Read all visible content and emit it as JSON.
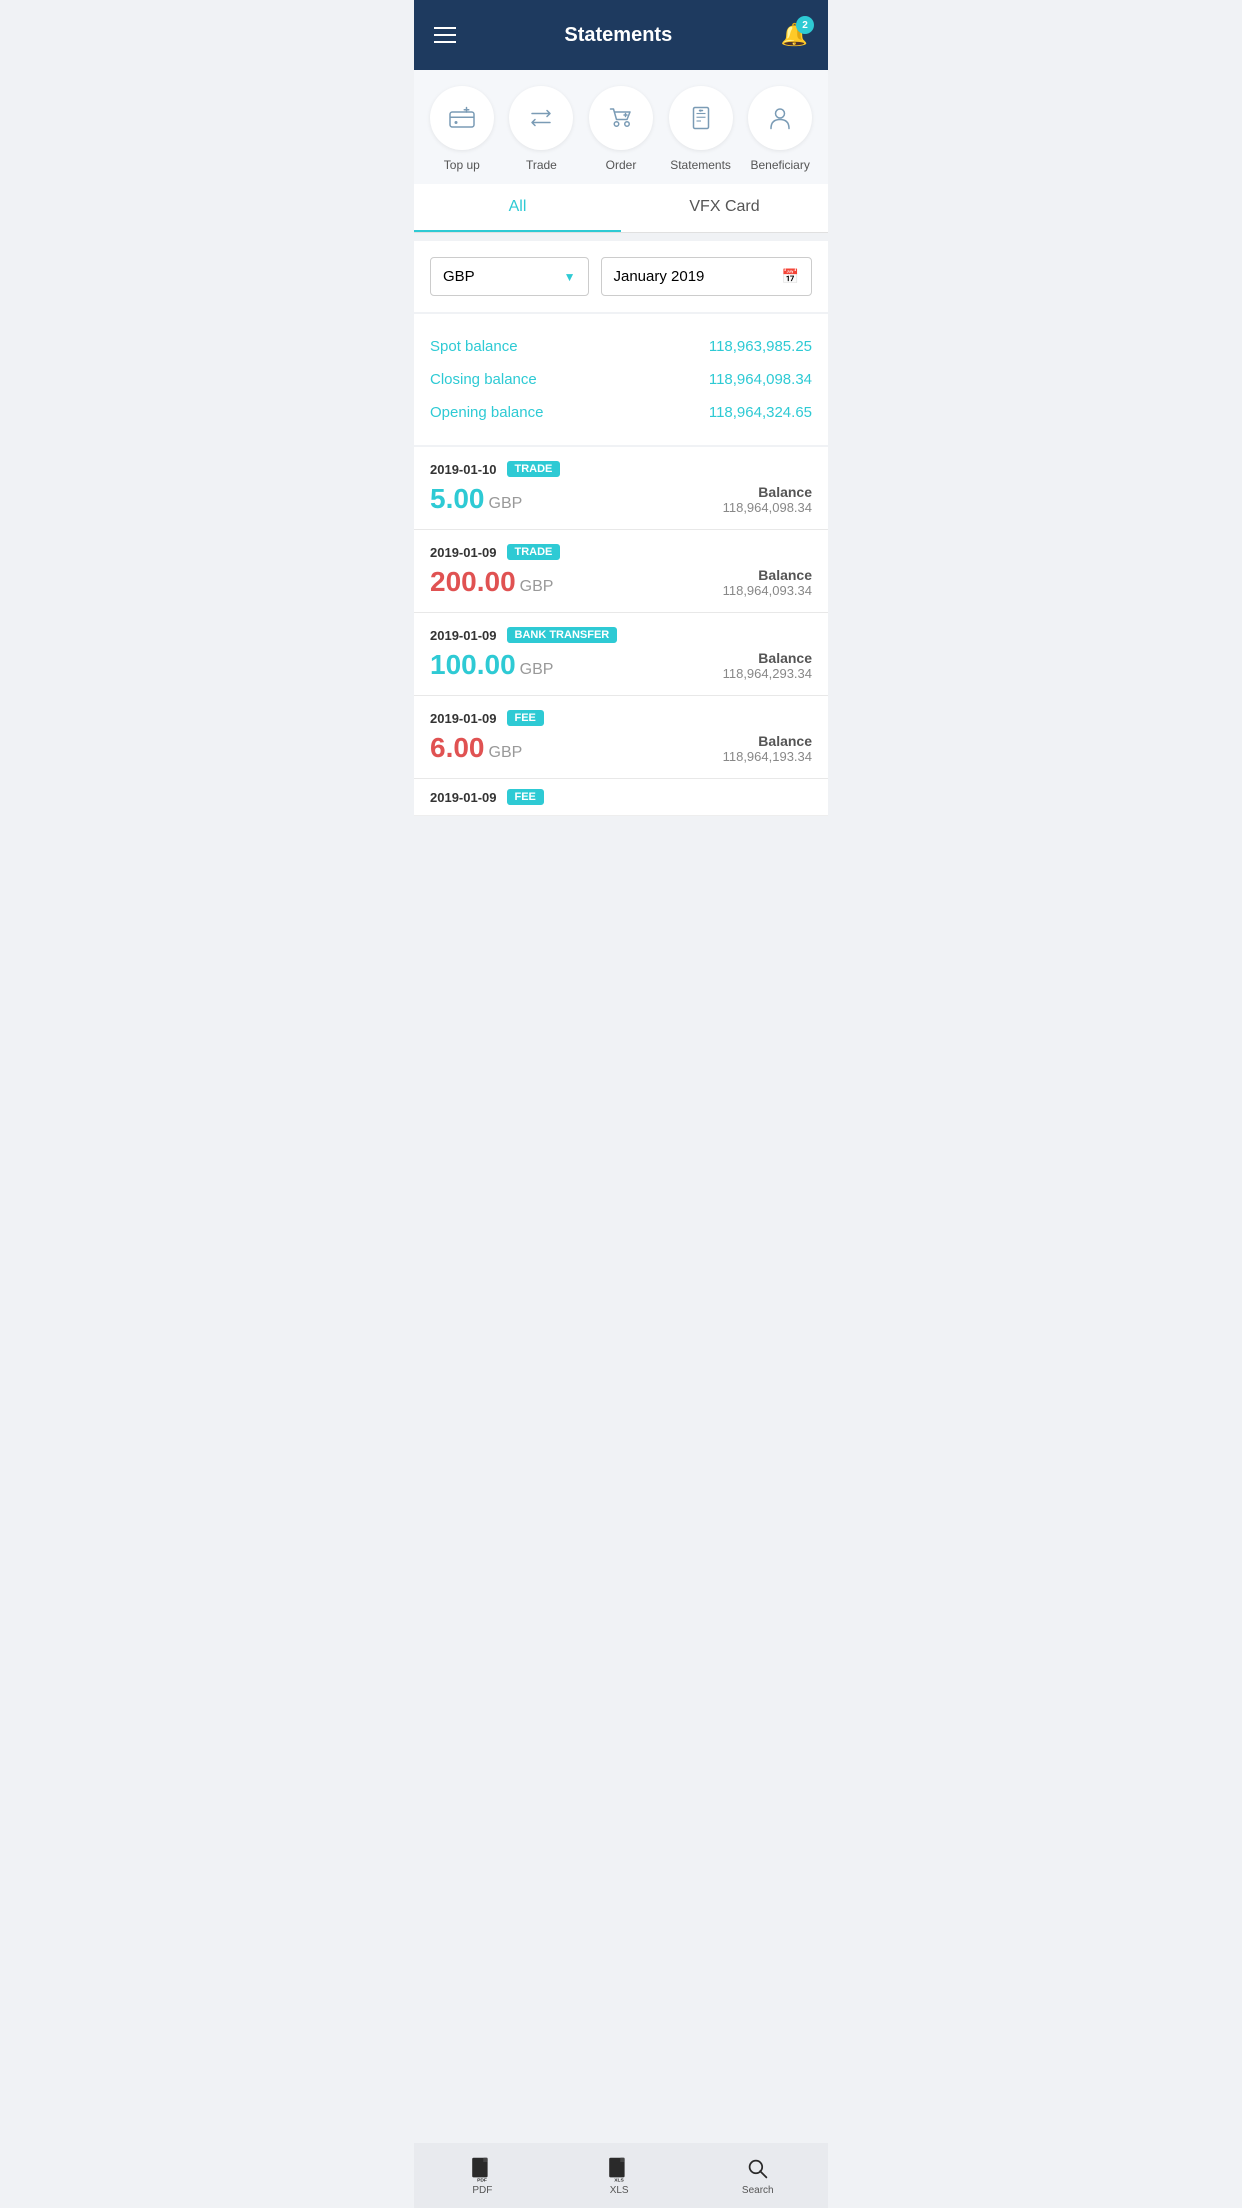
{
  "header": {
    "title": "Statements",
    "notification_count": "2"
  },
  "quick_actions": [
    {
      "id": "top-up",
      "label": "Top up",
      "icon": "wallet"
    },
    {
      "id": "trade",
      "label": "Trade",
      "icon": "trade"
    },
    {
      "id": "order",
      "label": "Order",
      "icon": "order"
    },
    {
      "id": "statements",
      "label": "Statements",
      "icon": "statements"
    },
    {
      "id": "beneficiary",
      "label": "Beneficiary",
      "icon": "beneficiary"
    }
  ],
  "tabs": [
    {
      "id": "all",
      "label": "All",
      "active": true
    },
    {
      "id": "vfx-card",
      "label": "VFX Card",
      "active": false
    }
  ],
  "filter": {
    "currency": "GBP",
    "period": "January 2019"
  },
  "balances": [
    {
      "label": "Spot balance",
      "value": "118,963,985.25"
    },
    {
      "label": "Closing balance",
      "value": "118,964,098.34"
    },
    {
      "label": "Opening balance",
      "value": "118,964,324.65"
    }
  ],
  "transactions": [
    {
      "date": "2019-01-10",
      "type": "TRADE",
      "amount": "5.00",
      "currency": "GBP",
      "positive": true,
      "balance_label": "Balance",
      "balance_value": "118,964,098.34"
    },
    {
      "date": "2019-01-09",
      "type": "TRADE",
      "amount": "200.00",
      "currency": "GBP",
      "positive": false,
      "balance_label": "Balance",
      "balance_value": "118,964,093.34"
    },
    {
      "date": "2019-01-09",
      "type": "BANK TRANSFER",
      "amount": "100.00",
      "currency": "GBP",
      "positive": true,
      "balance_label": "Balance",
      "balance_value": "118,964,293.34"
    },
    {
      "date": "2019-01-09",
      "type": "FEE",
      "amount": "6.00",
      "currency": "GBP",
      "positive": false,
      "balance_label": "Balance",
      "balance_value": "118,964,193.34"
    }
  ],
  "partial_transaction": {
    "date": "2019-01-09",
    "type": "FEE"
  },
  "bottom_bar": {
    "pdf_label": "PDF",
    "xls_label": "XLS",
    "search_label": "Search"
  },
  "colors": {
    "teal": "#2ecad4",
    "navy": "#1e3a5f",
    "red": "#e05252"
  }
}
